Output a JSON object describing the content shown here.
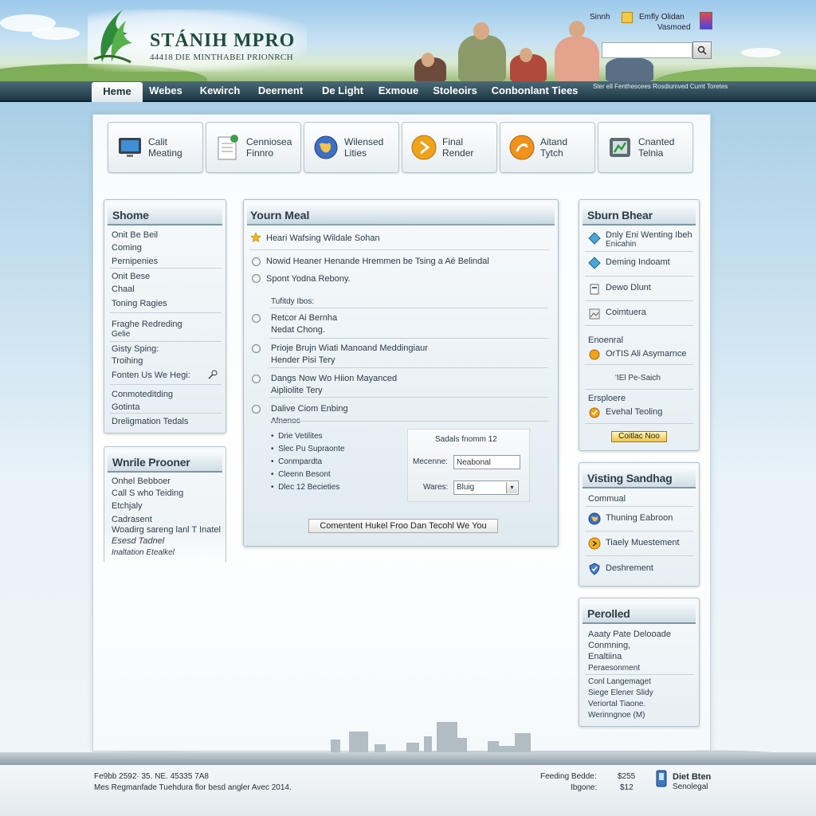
{
  "header": {
    "logo_title": "STÁNIH MPRO",
    "logo_sub": "44418 DIE MINTHABEI PRIONRCH",
    "utility_left": "Sinnh",
    "utility_right": "Emfly Olidan",
    "utility_right_sub": "Vasmoed",
    "search_placeholder": ""
  },
  "nav": {
    "items": [
      "Heme",
      "Webes",
      "Kewirch",
      "Deernent",
      "De Light",
      "Exmoue",
      "Stoleoirs",
      "Conbonlant Tiees"
    ],
    "active_index": 0,
    "tagline": "Ster ell Fenthescees Rosdiumved Cumt Toretes"
  },
  "tiles": [
    {
      "label": "Calit\nMeating",
      "icon": "monitor-icon"
    },
    {
      "label": "Cenniosea\nFinnro",
      "icon": "document-icon"
    },
    {
      "label": "Wilensed\nLities",
      "icon": "globe-icon"
    },
    {
      "label": "Final\nRender",
      "icon": "orange-arrow-icon"
    },
    {
      "label": "Aitand\nTytch",
      "icon": "orange-swirl-icon"
    },
    {
      "label": "Cnanted\nTelnia",
      "icon": "chart-box-icon"
    }
  ],
  "left_box1": {
    "title": "Shome",
    "items": [
      "Onit Be Beil",
      "Coming",
      "Pernipenies",
      "Onit Bese",
      "Chaal",
      "Toning Ragies",
      "Fraghe Redreding",
      "Gelie",
      "Gisty Sping:",
      "Troihing",
      "Fonten Us We Hegi:",
      "Conmoteditding",
      "Gotinta",
      "Dreligmation Tedals"
    ]
  },
  "left_box2": {
    "title": "Wnrile Prooner",
    "items": [
      "Onhel Bebboer",
      "Call S who Teiding",
      "Etchjaly",
      "Cadrasent",
      "Woadirg sareng lanl T Inatel",
      "Esesd Tadnel",
      "Inaltation Etealkel"
    ]
  },
  "center": {
    "title": "Yourn Meal",
    "featured": "Heari Wafsing Wildale Sohan",
    "options": [
      "Nowid Heaner Henande Hremmen be Tsing a Aé Belindal",
      "Spont Yodna Rebony."
    ],
    "subhead": "Tufitdy Ibos:",
    "entries": [
      {
        "title": "Retcor Ai Bernha",
        "sub": "Nedat Chong."
      },
      {
        "title": "Prioje Brujn Wiati Manoand Meddingiaur",
        "sub": "Hender Pisi Tery"
      },
      {
        "title": "Dangs Now Wo Hiion Mayanced",
        "sub": "Aipliolite Tery"
      },
      {
        "title": "Dalive Ciom Enbing",
        "sub": "Afnenoc"
      }
    ],
    "bullets": [
      "Drie Vetilites",
      "Slec Pu Supraonte",
      "Conmpardta",
      "Cleenn Besont",
      "Dlec 12 Becieties"
    ],
    "form_title": "Sadals fnomm 12",
    "form_label1": "Mecenne:",
    "form_value1": "Neabonal",
    "form_label2": "Wares:",
    "form_value2": "Bluig",
    "cta": "Comentent Hukel Froo Dan Tecohl We You"
  },
  "right_box1": {
    "title": "Sburn Bhear",
    "items": [
      "Dnly Eni Wenting Ibeh",
      "Enicahin",
      "Deming Indoamt",
      "Dewo Dlunt",
      "Coimtuera",
      "Enoenral",
      "OrTIS Ali Asymarnce",
      "'IEl Pe-Saich",
      "Ersploere",
      "Evehal Teoling"
    ],
    "button": "Coitlac Noo"
  },
  "right_box2": {
    "title": "Visting Sandhag",
    "items": [
      "Commual",
      "Thuning Eabroon",
      "Tiaely Muestement",
      "Deshrement"
    ]
  },
  "right_box3": {
    "title": "Perolled",
    "items": [
      "Aaaty Pate Delooade",
      "Conmning,",
      "Enaltiina",
      "Peraesonment",
      "Conl Langemaget",
      "Siege Elener Slidy",
      "Veriortal Tiaone.",
      "Werinngnoe (M)"
    ]
  },
  "footer": {
    "line1": "Fe9bb  2592·  35. NE.  45335  7A8",
    "line2": "Mes Regmanfade Tuehdura  flor besd angler Avec 2014.",
    "stat1_label": "Feeding  Bedde:",
    "stat1_value": "$255",
    "stat2_label": "Ibgone:",
    "stat2_value": "$12",
    "brand_name": "Diet Bten",
    "brand_sub": "Senolegal"
  },
  "colors": {
    "nav_bg": "#2a4654",
    "accent_orange": "#f0a21b",
    "logo_green": "#2f8a3a"
  }
}
